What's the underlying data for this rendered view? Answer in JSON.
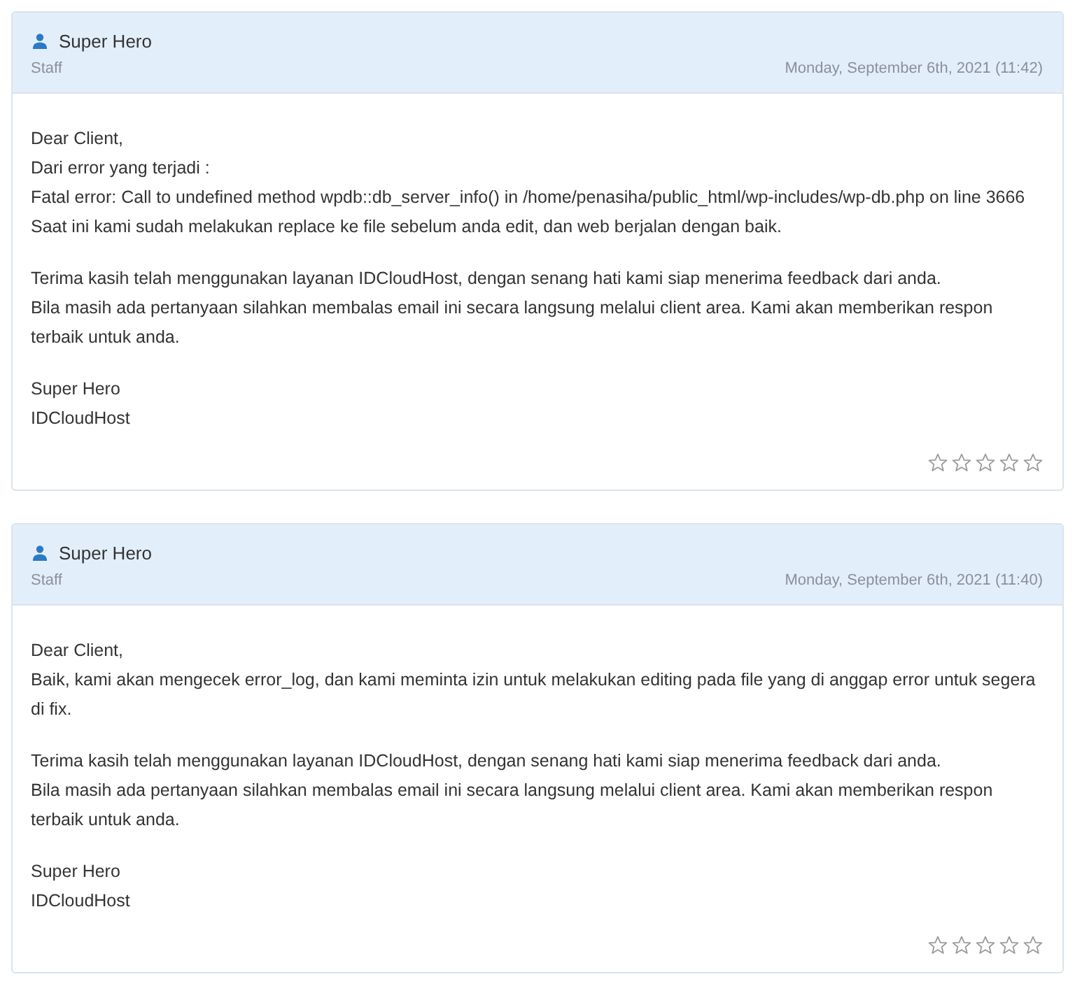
{
  "messages": [
    {
      "author": "Super Hero",
      "role": "Staff",
      "date": "Monday, September 6th, 2021 (11:42)",
      "paragraphs": [
        [
          "Dear Client,",
          "Dari error yang terjadi :",
          "Fatal error: Call to undefined method wpdb::db_server_info() in /home/penasiha/public_html/wp-includes/wp-db.php on line 3666",
          "Saat ini kami sudah melakukan replace ke file sebelum anda edit, dan web berjalan dengan baik."
        ],
        [
          "Terima kasih telah menggunakan layanan IDCloudHost, dengan senang hati kami siap menerima feedback dari anda.",
          "Bila masih ada pertanyaan silahkan membalas email ini secara langsung melalui client area. Kami akan memberikan respon terbaik untuk anda."
        ],
        [
          "Super Hero",
          "IDCloudHost"
        ]
      ],
      "stars": 0
    },
    {
      "author": "Super Hero",
      "role": "Staff",
      "date": "Monday, September 6th, 2021 (11:40)",
      "paragraphs": [
        [
          "Dear Client,",
          "Baik, kami akan mengecek error_log, dan kami meminta izin untuk melakukan editing pada file yang di anggap error untuk segera di fix."
        ],
        [
          "Terima kasih telah menggunakan layanan IDCloudHost, dengan senang hati kami siap menerima feedback dari anda.",
          "Bila masih ada pertanyaan silahkan membalas email ini secara langsung melalui client area. Kami akan memberikan respon terbaik untuk anda."
        ],
        [
          "Super Hero",
          "IDCloudHost"
        ]
      ],
      "stars": 0
    }
  ]
}
